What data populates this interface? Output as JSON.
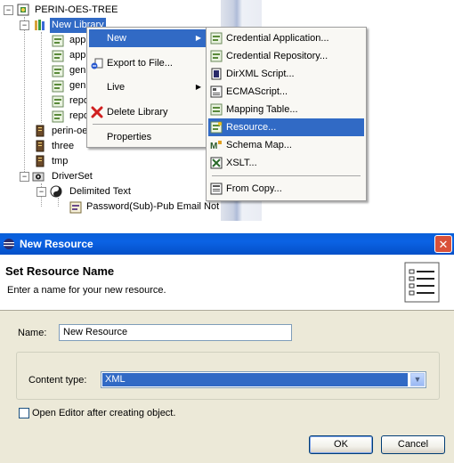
{
  "tree": {
    "root_label": "PERIN-OES-TREE",
    "selected_label": "New Library",
    "children": [
      "app",
      "app",
      "gen",
      "gen",
      "repo",
      "repo"
    ],
    "others": [
      "perin-oe",
      "three",
      "tmp"
    ],
    "driverset": "DriverSet",
    "driver": "Delimited Text",
    "policy": "Password(Sub)-Pub Email Not"
  },
  "context_menu": {
    "items": [
      {
        "label": "New",
        "has_submenu": true
      },
      {
        "label": "Export to File...",
        "has_submenu": false
      },
      {
        "label": "Live",
        "has_submenu": true
      },
      {
        "label": "Delete Library",
        "has_submenu": false
      },
      {
        "label": "Properties",
        "has_submenu": false
      }
    ],
    "highlighted": "New"
  },
  "submenu": {
    "items": [
      {
        "label": "Credential Application...",
        "icon": "credential-app-icon"
      },
      {
        "label": "Credential Repository...",
        "icon": "credential-repo-icon"
      },
      {
        "label": "DirXML Script...",
        "icon": "dirxml-script-icon"
      },
      {
        "label": "ECMAScript...",
        "icon": "ecmascript-icon"
      },
      {
        "label": "Mapping Table...",
        "icon": "mapping-table-icon"
      },
      {
        "label": "Resource...",
        "icon": "resource-icon"
      },
      {
        "label": "Schema Map...",
        "icon": "schema-map-icon"
      },
      {
        "label": "XSLT...",
        "icon": "xslt-icon"
      },
      {
        "label": "From Copy...",
        "icon": "from-copy-icon"
      }
    ],
    "highlighted": "Resource..."
  },
  "dialog": {
    "title": "New Resource",
    "heading": "Set Resource Name",
    "subheading": "Enter a name for your new resource.",
    "name_label": "Name:",
    "name_value": "New Resource",
    "content_type_label": "Content type:",
    "content_type_value": "XML",
    "checkbox_label": "Open Editor after creating object.",
    "checkbox_checked": false,
    "ok_label": "OK",
    "cancel_label": "Cancel"
  },
  "colors": {
    "selection": "#316ac5",
    "titlebar": "#0b62e4",
    "dialog_bg": "#ece9d8",
    "close": "#d9513a"
  }
}
